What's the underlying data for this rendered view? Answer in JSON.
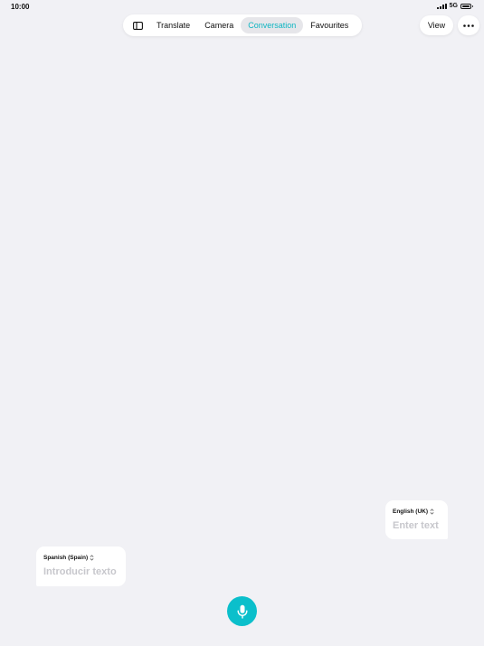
{
  "status_bar": {
    "time": "10:00",
    "network": "5G"
  },
  "nav": {
    "tabs": [
      {
        "label": "Translate"
      },
      {
        "label": "Camera"
      },
      {
        "label": "Conversation",
        "active": true
      },
      {
        "label": "Favourites"
      }
    ]
  },
  "header": {
    "view_label": "View"
  },
  "conversation": {
    "english": {
      "language": "English (UK)",
      "placeholder": "Enter text"
    },
    "spanish": {
      "language": "Spanish (Spain)",
      "placeholder": "Introducir texto"
    }
  },
  "colors": {
    "accent": "#0bbfcb",
    "background": "#f1f1f5"
  },
  "icons": {
    "sidebar": "sidebar-icon",
    "more": "ellipsis-icon",
    "mic": "microphone-icon",
    "chevrons": "chevron-up-down-icon"
  }
}
